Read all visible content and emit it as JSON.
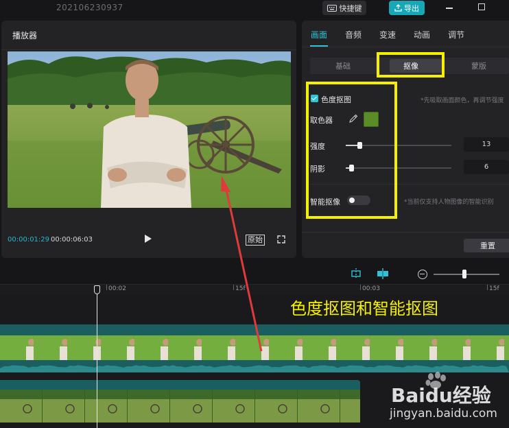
{
  "titlebar": {
    "project_name": "202106230937",
    "shortcut_label": "快捷键",
    "export_label": "导出"
  },
  "player": {
    "title": "播放器",
    "current_time": "00:00:01:29",
    "total_time": "00:00:06:03",
    "original_label": "原始"
  },
  "panel": {
    "tabs": [
      "画面",
      "音频",
      "变速",
      "动画",
      "调节"
    ],
    "active_tab": "画面",
    "subtabs": [
      "基础",
      "抠像",
      "蒙版"
    ],
    "active_subtab": "抠像",
    "chroma_key": {
      "checkbox_label": "色度抠图",
      "checked": true,
      "hint": "*先吸取画面颜色，再调节强度",
      "picker_label": "取色器",
      "picked_color": "#5a8c28",
      "strength_label": "强度",
      "strength_value": "13",
      "shadow_label": "阴影",
      "shadow_value": "6"
    },
    "smart_cutout": {
      "label": "智能抠像",
      "enabled": false,
      "hint": "*当前仅支持人物图像的智能识别"
    },
    "reset_label": "重置"
  },
  "timeline": {
    "ruler_labels": [
      "00:02",
      "15f",
      "00:03",
      "15f"
    ],
    "zoom_level": 0.44
  },
  "annotation": {
    "text": "色度抠图和智能抠图",
    "color": "#f5f000"
  },
  "watermark": {
    "brand": "Baidu经验",
    "url": "jingyan.baidu.com"
  },
  "colors": {
    "accent": "#2fc3d6",
    "export_bg": "#17a8b8",
    "highlight": "#f5f000",
    "arrow": "#e03a3a"
  }
}
